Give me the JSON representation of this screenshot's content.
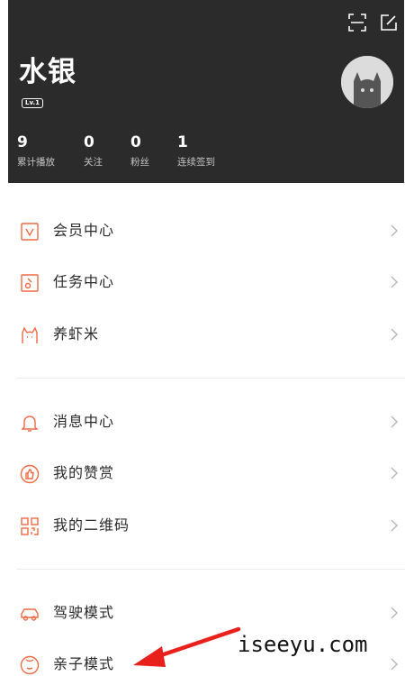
{
  "profile": {
    "username": "水银",
    "level": "Lv.1",
    "stats": [
      {
        "value": "9",
        "label": "累计播放"
      },
      {
        "value": "0",
        "label": "关注"
      },
      {
        "value": "0",
        "label": "粉丝"
      },
      {
        "value": "1",
        "label": "连续签到"
      }
    ]
  },
  "menu": {
    "group1": [
      {
        "label": "会员中心",
        "icon": "vip-icon"
      },
      {
        "label": "任务中心",
        "icon": "task-icon"
      },
      {
        "label": "养虾米",
        "icon": "cat-icon"
      }
    ],
    "group2": [
      {
        "label": "消息中心",
        "icon": "bell-icon"
      },
      {
        "label": "我的赞赏",
        "icon": "thumbs-up-icon"
      },
      {
        "label": "我的二维码",
        "icon": "qrcode-icon"
      }
    ],
    "group3": [
      {
        "label": "驾驶模式",
        "icon": "car-icon"
      },
      {
        "label": "亲子模式",
        "icon": "baby-icon"
      }
    ]
  },
  "watermark": "iseeyu.com",
  "colors": {
    "header_bg": "#2b2b2b",
    "accent": "#ee6a45",
    "arrow": "#e8211d"
  }
}
